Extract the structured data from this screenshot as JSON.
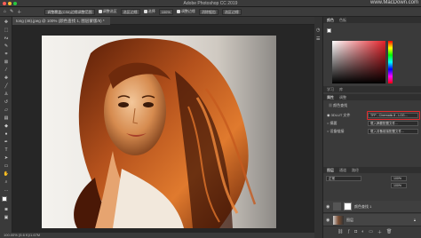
{
  "window": {
    "title": "Adobe Photoshop CC 2019",
    "watermark": "www.MacDown.com"
  },
  "options": {
    "btn1": "调整覆盖(CS6)边缘调整范围",
    "check1": "调整选区",
    "btn2": "选区边缘",
    "check2": "选择",
    "btn3": "100%",
    "check3": "调整边缘",
    "btn4": "消除锯齿",
    "btn5": "选区边缘"
  },
  "document": {
    "tab": "tong (46).jpeg @ 100% (颜色查找 1, 图层蒙版/8) *",
    "status": "100.00%  (5.6 K)/1.67M"
  },
  "panels": {
    "color_tabs": [
      "颜色",
      "色板"
    ],
    "lib_tabs": [
      "学习",
      "库"
    ],
    "props_tabs": [
      "属性",
      "调整"
    ],
    "props_title": "颜色查找",
    "lut_label": "3DLUT 文件",
    "lut_value": "TFP - Cinematic 8 - LOG...",
    "abstract_label": "摘要",
    "abstract_value": "载入摘要配置文件...",
    "devicelink_label": "设备链接",
    "devicelink_value": "载入设备链接配置文件...",
    "layers_tabs": [
      "图层",
      "通道",
      "路径"
    ],
    "layers_mode": "正常",
    "layers_opacity": "100%",
    "fill_value": "100%",
    "layers": [
      {
        "name": "颜色查找 1"
      },
      {
        "name": "图层"
      }
    ]
  },
  "colors": {
    "highlight": "#e12c2c",
    "foreground": "#ffffff",
    "background": "#000000"
  }
}
